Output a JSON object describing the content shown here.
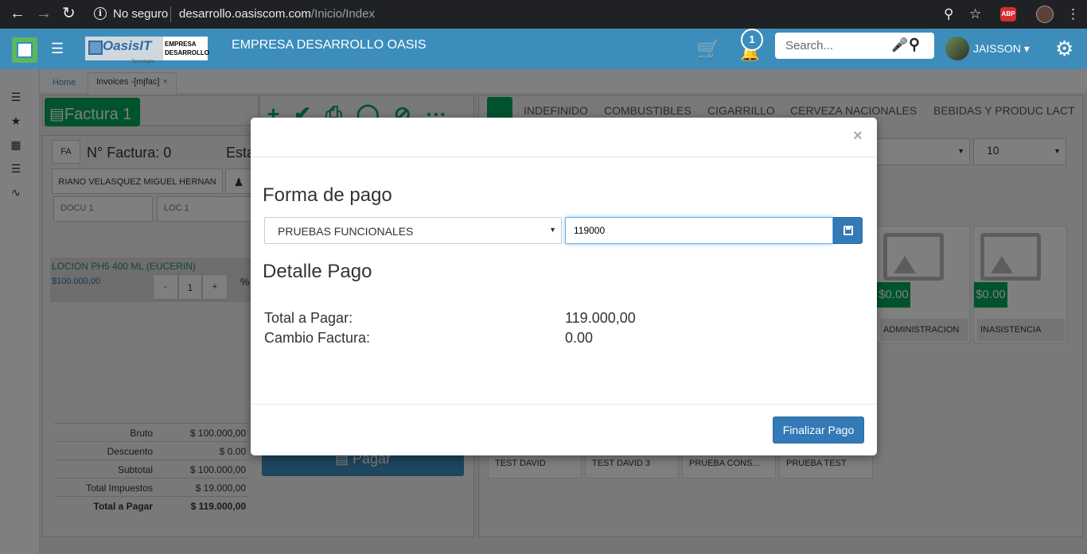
{
  "browser": {
    "security_label": "No seguro",
    "url_host": "desarrollo.oasiscom.com",
    "url_path": "/Inicio/Index",
    "adblock_label": "ABP"
  },
  "header": {
    "brand_main": "OasisIT",
    "brand_tag": "Tecnología",
    "brand_line1": "EMPRESA",
    "brand_line2": "DESARROLLO",
    "company": "EMPRESA DESARROLLO OASIS",
    "notification_count": "1",
    "search_placeholder": "Search...",
    "user": "JAISSON",
    "accent_color": "#3c8dbc"
  },
  "tabs": [
    {
      "label": "Home"
    },
    {
      "label": "Invoices -[mjfac]",
      "close": "×"
    }
  ],
  "invoice": {
    "factura_button": "Factura 1",
    "prefix": "FA",
    "number_label": "N° Factura: 0",
    "estado_partial": "Esta",
    "customer": "RIANO VELASQUEZ MIGUEL HERNAN",
    "docu": "DOCU 1",
    "loc": "LOC 1",
    "item_name": "LOCION PH5 400 ML (EUCERIN)",
    "item_price": "$100.000,00",
    "qty_minus": "-",
    "qty": "1",
    "qty_plus": "+",
    "pct": "%",
    "pay_button": "Pagar",
    "totals": [
      {
        "label": "Bruto",
        "value": "$ 100.000,00"
      },
      {
        "label": "Descuento",
        "value": "$ 0.00"
      },
      {
        "label": "Subtotal",
        "value": "$ 100.000,00"
      },
      {
        "label": "Total Impuestos",
        "value": "$ 19.000,00"
      },
      {
        "label": "Total a Pagar",
        "value": "$ 119.000,00"
      }
    ]
  },
  "catalog": {
    "categories": [
      "INDEFINIDO",
      "COMBUSTIBLES",
      "CIGARRILLO",
      "CERVEZA NACIONALES",
      "BEBIDAS Y PRODUC LACT"
    ],
    "select_partial": "s",
    "page_size": "10",
    "products": [
      {
        "price": "$0.00",
        "name": "ADMINISTRACION"
      },
      {
        "price": "$0.00",
        "name": "INASISTENCIA"
      }
    ],
    "small_items": [
      "TEST DAVID",
      "TEST DAVID 3",
      "PRUEBA CONS...",
      "PRUEBA TEST"
    ]
  },
  "modal": {
    "close": "×",
    "forma_title": "Forma de pago",
    "payment_method": "PRUEBAS FUNCIONALES",
    "amount_value": "119000",
    "detalle_title": "Detalle Pago",
    "total_label": "Total a Pagar:",
    "total_value": "119.000,00",
    "cambio_label": "Cambio Factura:",
    "cambio_value": "0.00",
    "finalize_button": "Finalizar Pago"
  }
}
